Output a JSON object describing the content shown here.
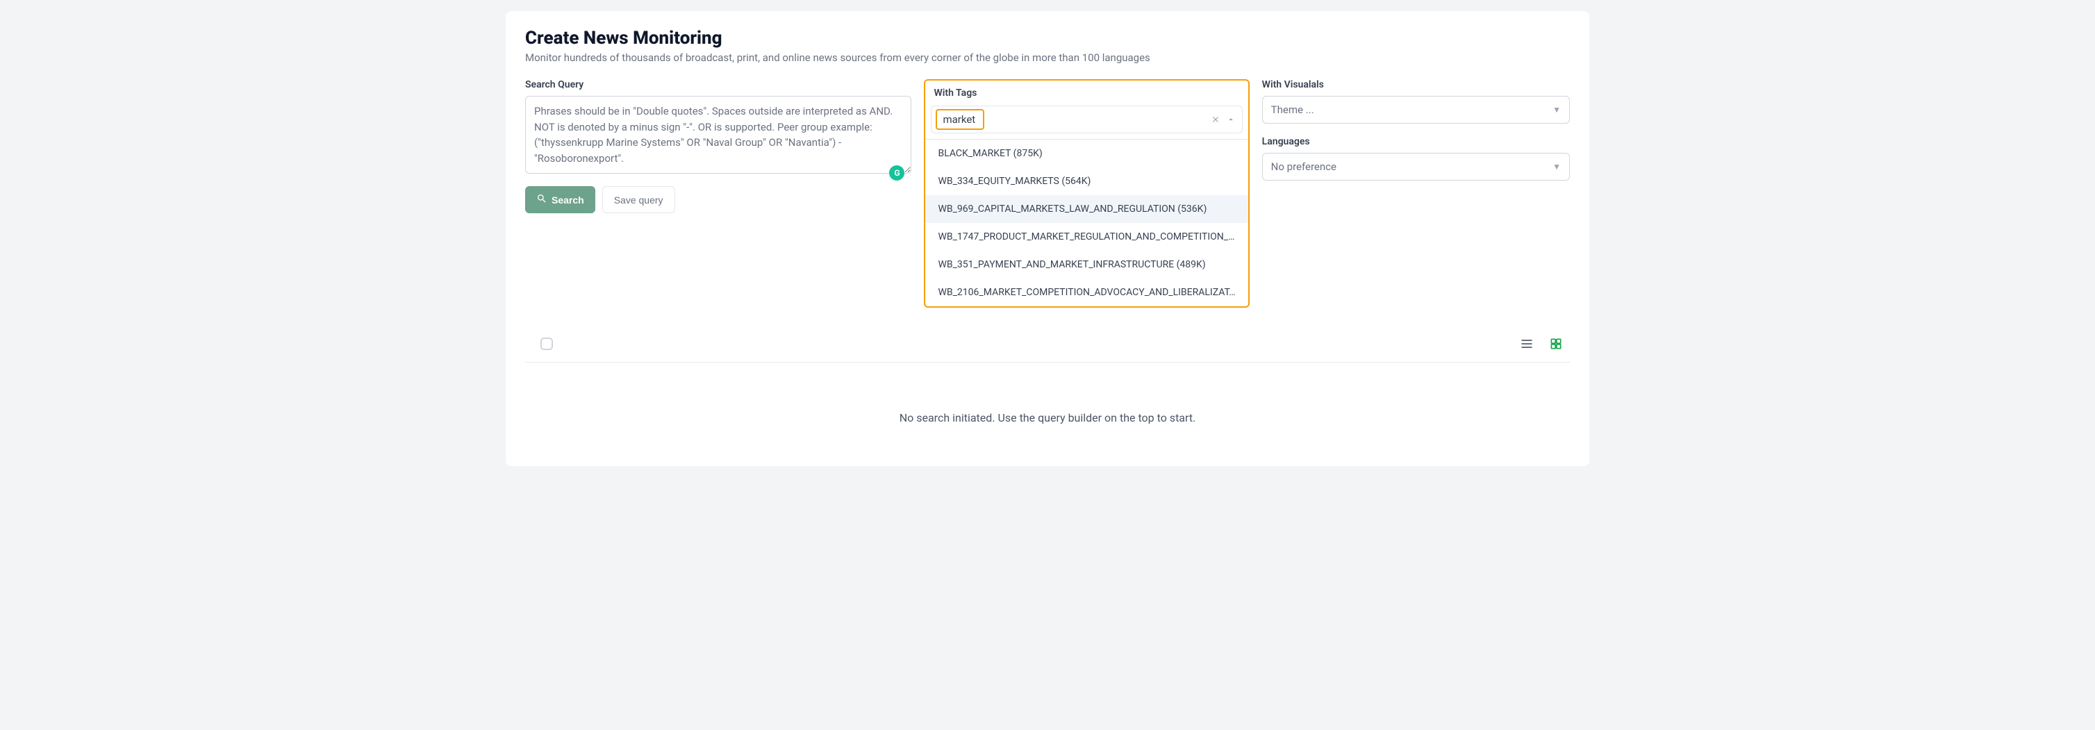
{
  "header": {
    "title": "Create News Monitoring",
    "subtitle": "Monitor hundreds of thousands of broadcast, print, and online news sources from every corner of the globe in more than 100 languages"
  },
  "query": {
    "label": "Search Query",
    "placeholder": "Phrases should be in \"Double quotes\". Spaces outside are interpreted as AND. NOT is denoted by a minus sign \"-\". OR is supported. Peer group example: (\"thyssenkrupp Marine Systems\" OR \"Naval Group\" OR \"Navantia\") -\"Rosoboronexport\".",
    "value": ""
  },
  "buttons": {
    "search": "Search",
    "save": "Save query"
  },
  "tags": {
    "label": "With Tags",
    "input_value": "market",
    "options": [
      "BLACK_MARKET (875K)",
      "WB_334_EQUITY_MARKETS (564K)",
      "WB_969_CAPITAL_MARKETS_LAW_AND_REGULATION (536K)",
      "WB_1747_PRODUCT_MARKET_REGULATION_AND_COMPETITION_…",
      "WB_351_PAYMENT_AND_MARKET_INFRASTRUCTURE (489K)",
      "WB_2106_MARKET_COMPETITION_ADVOCACY_AND_LIBERALIZAT…"
    ],
    "highlighted_index": 2
  },
  "visuals": {
    "label": "With Visualals",
    "placeholder": "Theme ..."
  },
  "languages": {
    "label": "Languages",
    "placeholder": "No preference"
  },
  "empty_state": "No search initiated. Use the query builder on the top to start.",
  "grammarly_glyph": "G"
}
